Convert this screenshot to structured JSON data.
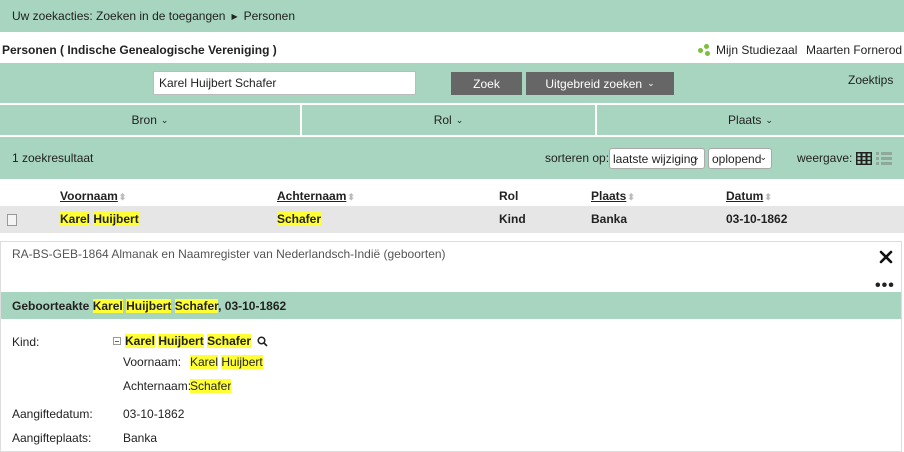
{
  "breadcrumb": {
    "prefix": "Uw zoekacties: Zoeken in de toegangen",
    "current": "Personen"
  },
  "header": {
    "title": "Personen ( Indische Genealogische Vereniging )",
    "studiezaal_label": "Mijn Studiezaal",
    "user_name": "Maarten Fornerod"
  },
  "search": {
    "value": "Karel Huijbert Schafer",
    "search_button": "Zoek",
    "advanced_button": "Uitgebreid zoeken",
    "tips_link": "Zoektips"
  },
  "facets": {
    "bron": "Bron",
    "rol": "Rol",
    "plaats": "Plaats"
  },
  "results": {
    "count_text": "1  zoekresultaat",
    "sort_label": "sorteren op:",
    "sort_value": "laatste wijziging",
    "order_value": "oplopend",
    "view_label": "weergave:"
  },
  "table": {
    "headers": {
      "voornaam": "Voornaam",
      "achternaam": "Achternaam",
      "rol": "Rol",
      "plaats": "Plaats",
      "datum": "Datum"
    },
    "rows": [
      {
        "voornaam_1": "Karel",
        "voornaam_2": "Huijbert",
        "achternaam": "Schafer",
        "rol": "Kind",
        "plaats": "Banka",
        "datum": "03-10-1862"
      }
    ]
  },
  "detail": {
    "source": "RA-BS-GEB-1864 Almanak en Naamregister van Nederlandsch-Indië (geboorten)",
    "deed_title_prefix": "Geboorteakte",
    "deed_name_1": "Karel",
    "deed_name_2": "Huijbert",
    "deed_name_3": "Schafer",
    "deed_date_suffix": ", 03-10-1862",
    "kind_label": "Kind:",
    "kind_name_1": "Karel",
    "kind_name_2": "Huijbert",
    "kind_name_3": "Schafer",
    "voornaam_label": "Voornaam:",
    "voornaam_value_1": "Karel",
    "voornaam_value_2": "Huijbert",
    "achternaam_label": "Achternaam:",
    "achternaam_value": "Schafer",
    "aangiftedatum_label": "Aangiftedatum:",
    "aangiftedatum_value": "03-10-1862",
    "aangifteplaats_label": "Aangifteplaats:",
    "aangifteplaats_value": "Banka"
  },
  "colors": {
    "accent_green": "#a8d5bf",
    "highlight": "#ffff33",
    "button_dark": "#666666"
  },
  "icons": {
    "studiezaal": "green-dots-icon",
    "facet_chevron": "chevron-down-icon",
    "grid_view": "grid-view-icon",
    "list_view": "list-view-icon",
    "close": "close-icon",
    "more": "more-icon",
    "magnify": "magnify-icon",
    "collapse": "collapse-icon",
    "document": "document-icon"
  }
}
